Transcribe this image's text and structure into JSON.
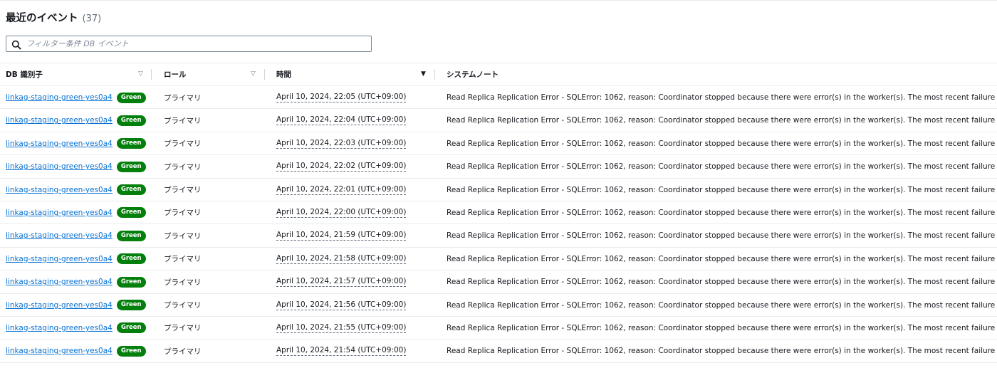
{
  "header": {
    "title": "最近のイベント",
    "count": "(37)"
  },
  "filter": {
    "placeholder": "フィルター条件 DB イベント",
    "value": ""
  },
  "columns": {
    "db": "DB 識別子",
    "role": "ロール",
    "time": "時間",
    "note": "システムノート"
  },
  "icons": {
    "search": "search-icon",
    "sort": "sort-down-icon"
  },
  "colors": {
    "link": "#0972d3",
    "badge": "#037f0c",
    "border": "#e9ebed"
  },
  "rows": [
    {
      "db": "linkag-staging-green-yes0a4",
      "badge": "Green",
      "role": "プライマリ",
      "time": "April 10, 2024, 22:05 (UTC+09:00)",
      "note": "Read Replica Replication Error - SQLError: 1062, reason: Coordinator stopped because there were error(s) in the worker(s). The most recent failure being: W"
    },
    {
      "db": "linkag-staging-green-yes0a4",
      "badge": "Green",
      "role": "プライマリ",
      "time": "April 10, 2024, 22:04 (UTC+09:00)",
      "note": "Read Replica Replication Error - SQLError: 1062, reason: Coordinator stopped because there were error(s) in the worker(s). The most recent failure being: W"
    },
    {
      "db": "linkag-staging-green-yes0a4",
      "badge": "Green",
      "role": "プライマリ",
      "time": "April 10, 2024, 22:03 (UTC+09:00)",
      "note": "Read Replica Replication Error - SQLError: 1062, reason: Coordinator stopped because there were error(s) in the worker(s). The most recent failure being: W"
    },
    {
      "db": "linkag-staging-green-yes0a4",
      "badge": "Green",
      "role": "プライマリ",
      "time": "April 10, 2024, 22:02 (UTC+09:00)",
      "note": "Read Replica Replication Error - SQLError: 1062, reason: Coordinator stopped because there were error(s) in the worker(s). The most recent failure being: W"
    },
    {
      "db": "linkag-staging-green-yes0a4",
      "badge": "Green",
      "role": "プライマリ",
      "time": "April 10, 2024, 22:01 (UTC+09:00)",
      "note": "Read Replica Replication Error - SQLError: 1062, reason: Coordinator stopped because there were error(s) in the worker(s). The most recent failure being: W"
    },
    {
      "db": "linkag-staging-green-yes0a4",
      "badge": "Green",
      "role": "プライマリ",
      "time": "April 10, 2024, 22:00 (UTC+09:00)",
      "note": "Read Replica Replication Error - SQLError: 1062, reason: Coordinator stopped because there were error(s) in the worker(s). The most recent failure being: W"
    },
    {
      "db": "linkag-staging-green-yes0a4",
      "badge": "Green",
      "role": "プライマリ",
      "time": "April 10, 2024, 21:59 (UTC+09:00)",
      "note": "Read Replica Replication Error - SQLError: 1062, reason: Coordinator stopped because there were error(s) in the worker(s). The most recent failure being: W"
    },
    {
      "db": "linkag-staging-green-yes0a4",
      "badge": "Green",
      "role": "プライマリ",
      "time": "April 10, 2024, 21:58 (UTC+09:00)",
      "note": "Read Replica Replication Error - SQLError: 1062, reason: Coordinator stopped because there were error(s) in the worker(s). The most recent failure being: W"
    },
    {
      "db": "linkag-staging-green-yes0a4",
      "badge": "Green",
      "role": "プライマリ",
      "time": "April 10, 2024, 21:57 (UTC+09:00)",
      "note": "Read Replica Replication Error - SQLError: 1062, reason: Coordinator stopped because there were error(s) in the worker(s). The most recent failure being: W"
    },
    {
      "db": "linkag-staging-green-yes0a4",
      "badge": "Green",
      "role": "プライマリ",
      "time": "April 10, 2024, 21:56 (UTC+09:00)",
      "note": "Read Replica Replication Error - SQLError: 1062, reason: Coordinator stopped because there were error(s) in the worker(s). The most recent failure being: W"
    },
    {
      "db": "linkag-staging-green-yes0a4",
      "badge": "Green",
      "role": "プライマリ",
      "time": "April 10, 2024, 21:55 (UTC+09:00)",
      "note": "Read Replica Replication Error - SQLError: 1062, reason: Coordinator stopped because there were error(s) in the worker(s). The most recent failure being: W"
    },
    {
      "db": "linkag-staging-green-yes0a4",
      "badge": "Green",
      "role": "プライマリ",
      "time": "April 10, 2024, 21:54 (UTC+09:00)",
      "note": "Read Replica Replication Error - SQLError: 1062, reason: Coordinator stopped because there were error(s) in the worker(s). The most recent failure being: W"
    }
  ]
}
